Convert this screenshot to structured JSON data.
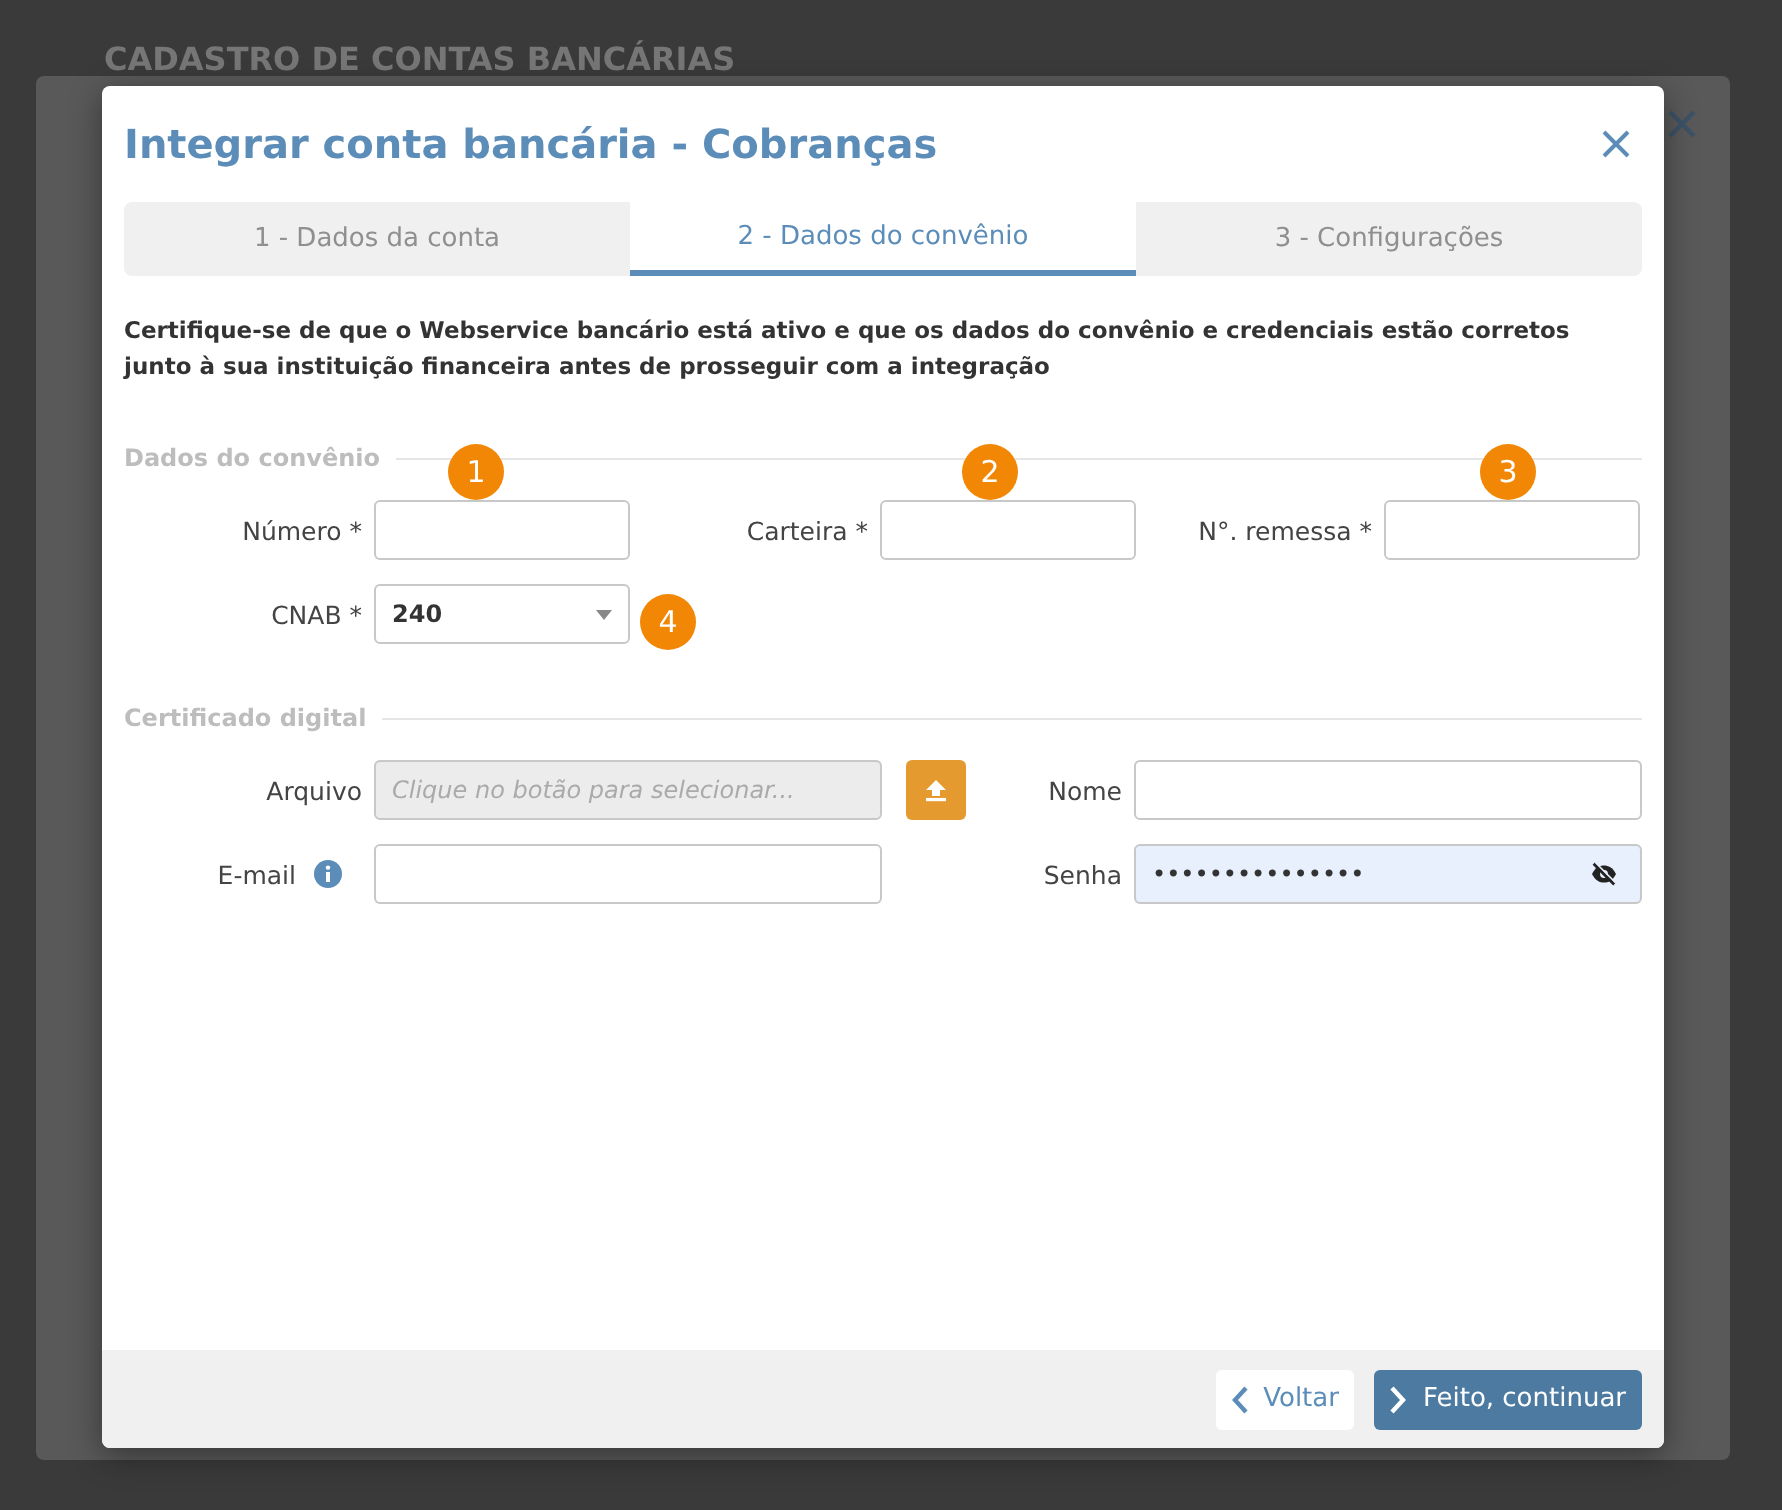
{
  "background_page": {
    "title": "CADASTRO DE CONTAS BANCÁRIAS"
  },
  "dialog": {
    "title": "Integrar conta bancária - Cobranças",
    "tabs": [
      {
        "label": "1 - Dados da conta",
        "selected": false
      },
      {
        "label": "2 - Dados do convênio",
        "selected": true
      },
      {
        "label": "3 - Configurações",
        "selected": false
      }
    ],
    "notice": "Certifique-se de que o Webservice bancário está ativo e que os dados do convênio e credenciais estão corretos junto à sua instituição financeira antes de prosseguir com a integração",
    "sections": [
      {
        "title": "Dados do convênio",
        "rows": [
          [
            {
              "kind": "text",
              "label": "Número *",
              "badge": "1"
            },
            {
              "kind": "text",
              "label": "Carteira *",
              "badge": "2"
            },
            {
              "kind": "text",
              "label": "N°. remessa *",
              "badge": "3"
            }
          ],
          [
            {
              "kind": "select",
              "label": "CNAB *",
              "value": "240",
              "badge": "4"
            }
          ]
        ]
      },
      {
        "title": "Certificado digital",
        "rows": [
          [
            {
              "kind": "file",
              "label": "Arquivo",
              "placeholder": "Clique no botão para selecionar...",
              "disabled": true
            },
            {
              "kind": "text",
              "label": "Nome"
            }
          ],
          [
            {
              "kind": "text",
              "label": "E-mail",
              "info": true
            },
            {
              "kind": "password",
              "label": "Senha",
              "value": "•••••••••••••••",
              "highlighted": true
            }
          ]
        ]
      }
    ],
    "buttons": [
      {
        "kind": "back",
        "label": "Voltar"
      },
      {
        "kind": "primary",
        "label": "Feito, continuar"
      }
    ]
  }
}
